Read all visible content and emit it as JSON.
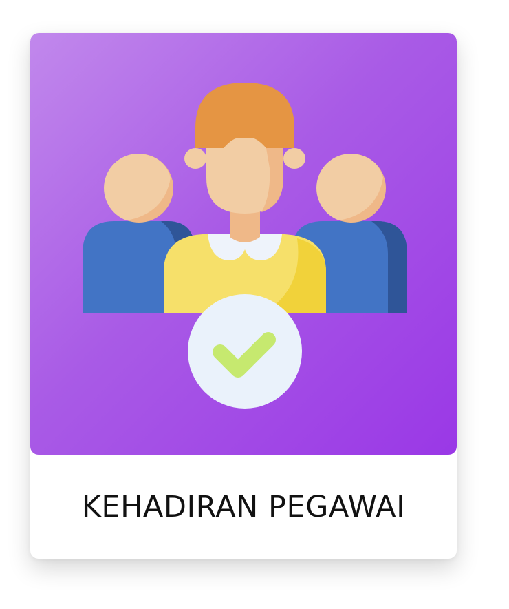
{
  "tile": {
    "label": "KEHADIRAN PEGAWAI",
    "icon": "employee-attendance-icon"
  },
  "colors": {
    "gradient_start": "#c188ec",
    "gradient_end": "#9a38e6",
    "label_text": "#111111",
    "hair": "#e59543",
    "skin": "#f2cda4",
    "skin_shade": "#efb888",
    "shirt_yellow": "#f6e06a",
    "shirt_yellow_shade": "#f1d23a",
    "shirt_blue": "#4274c5",
    "shirt_blue_shade": "#2f5598",
    "check_circle": "#eaf2fb",
    "check_mark": "#c6e96f"
  }
}
